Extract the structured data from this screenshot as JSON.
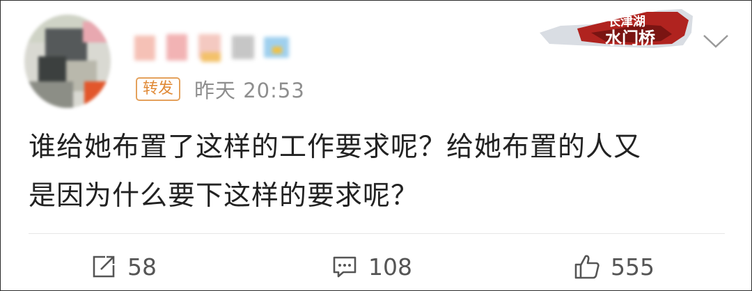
{
  "post": {
    "forward_tag": "转发",
    "timestamp": "昨天 20:53",
    "text_line_1": "谁给她布置了这样的工作要求呢？给她布置的人又",
    "text_line_2": "是因为什么要下这样的要求呢？"
  },
  "badge": {
    "line_1": "长津湖",
    "line_2": "水门桥"
  },
  "actions": {
    "repost_count": "58",
    "comment_count": "108",
    "like_count": "555"
  },
  "colors": {
    "forward_tag": "#e08a37",
    "timestamp": "#8e8e8e",
    "text": "#222222",
    "badge_red": "#b0231f"
  },
  "icons": {
    "repost": "share-icon",
    "comment": "comment-icon",
    "like": "thumbs-up-icon",
    "menu": "chevron-down-icon"
  }
}
